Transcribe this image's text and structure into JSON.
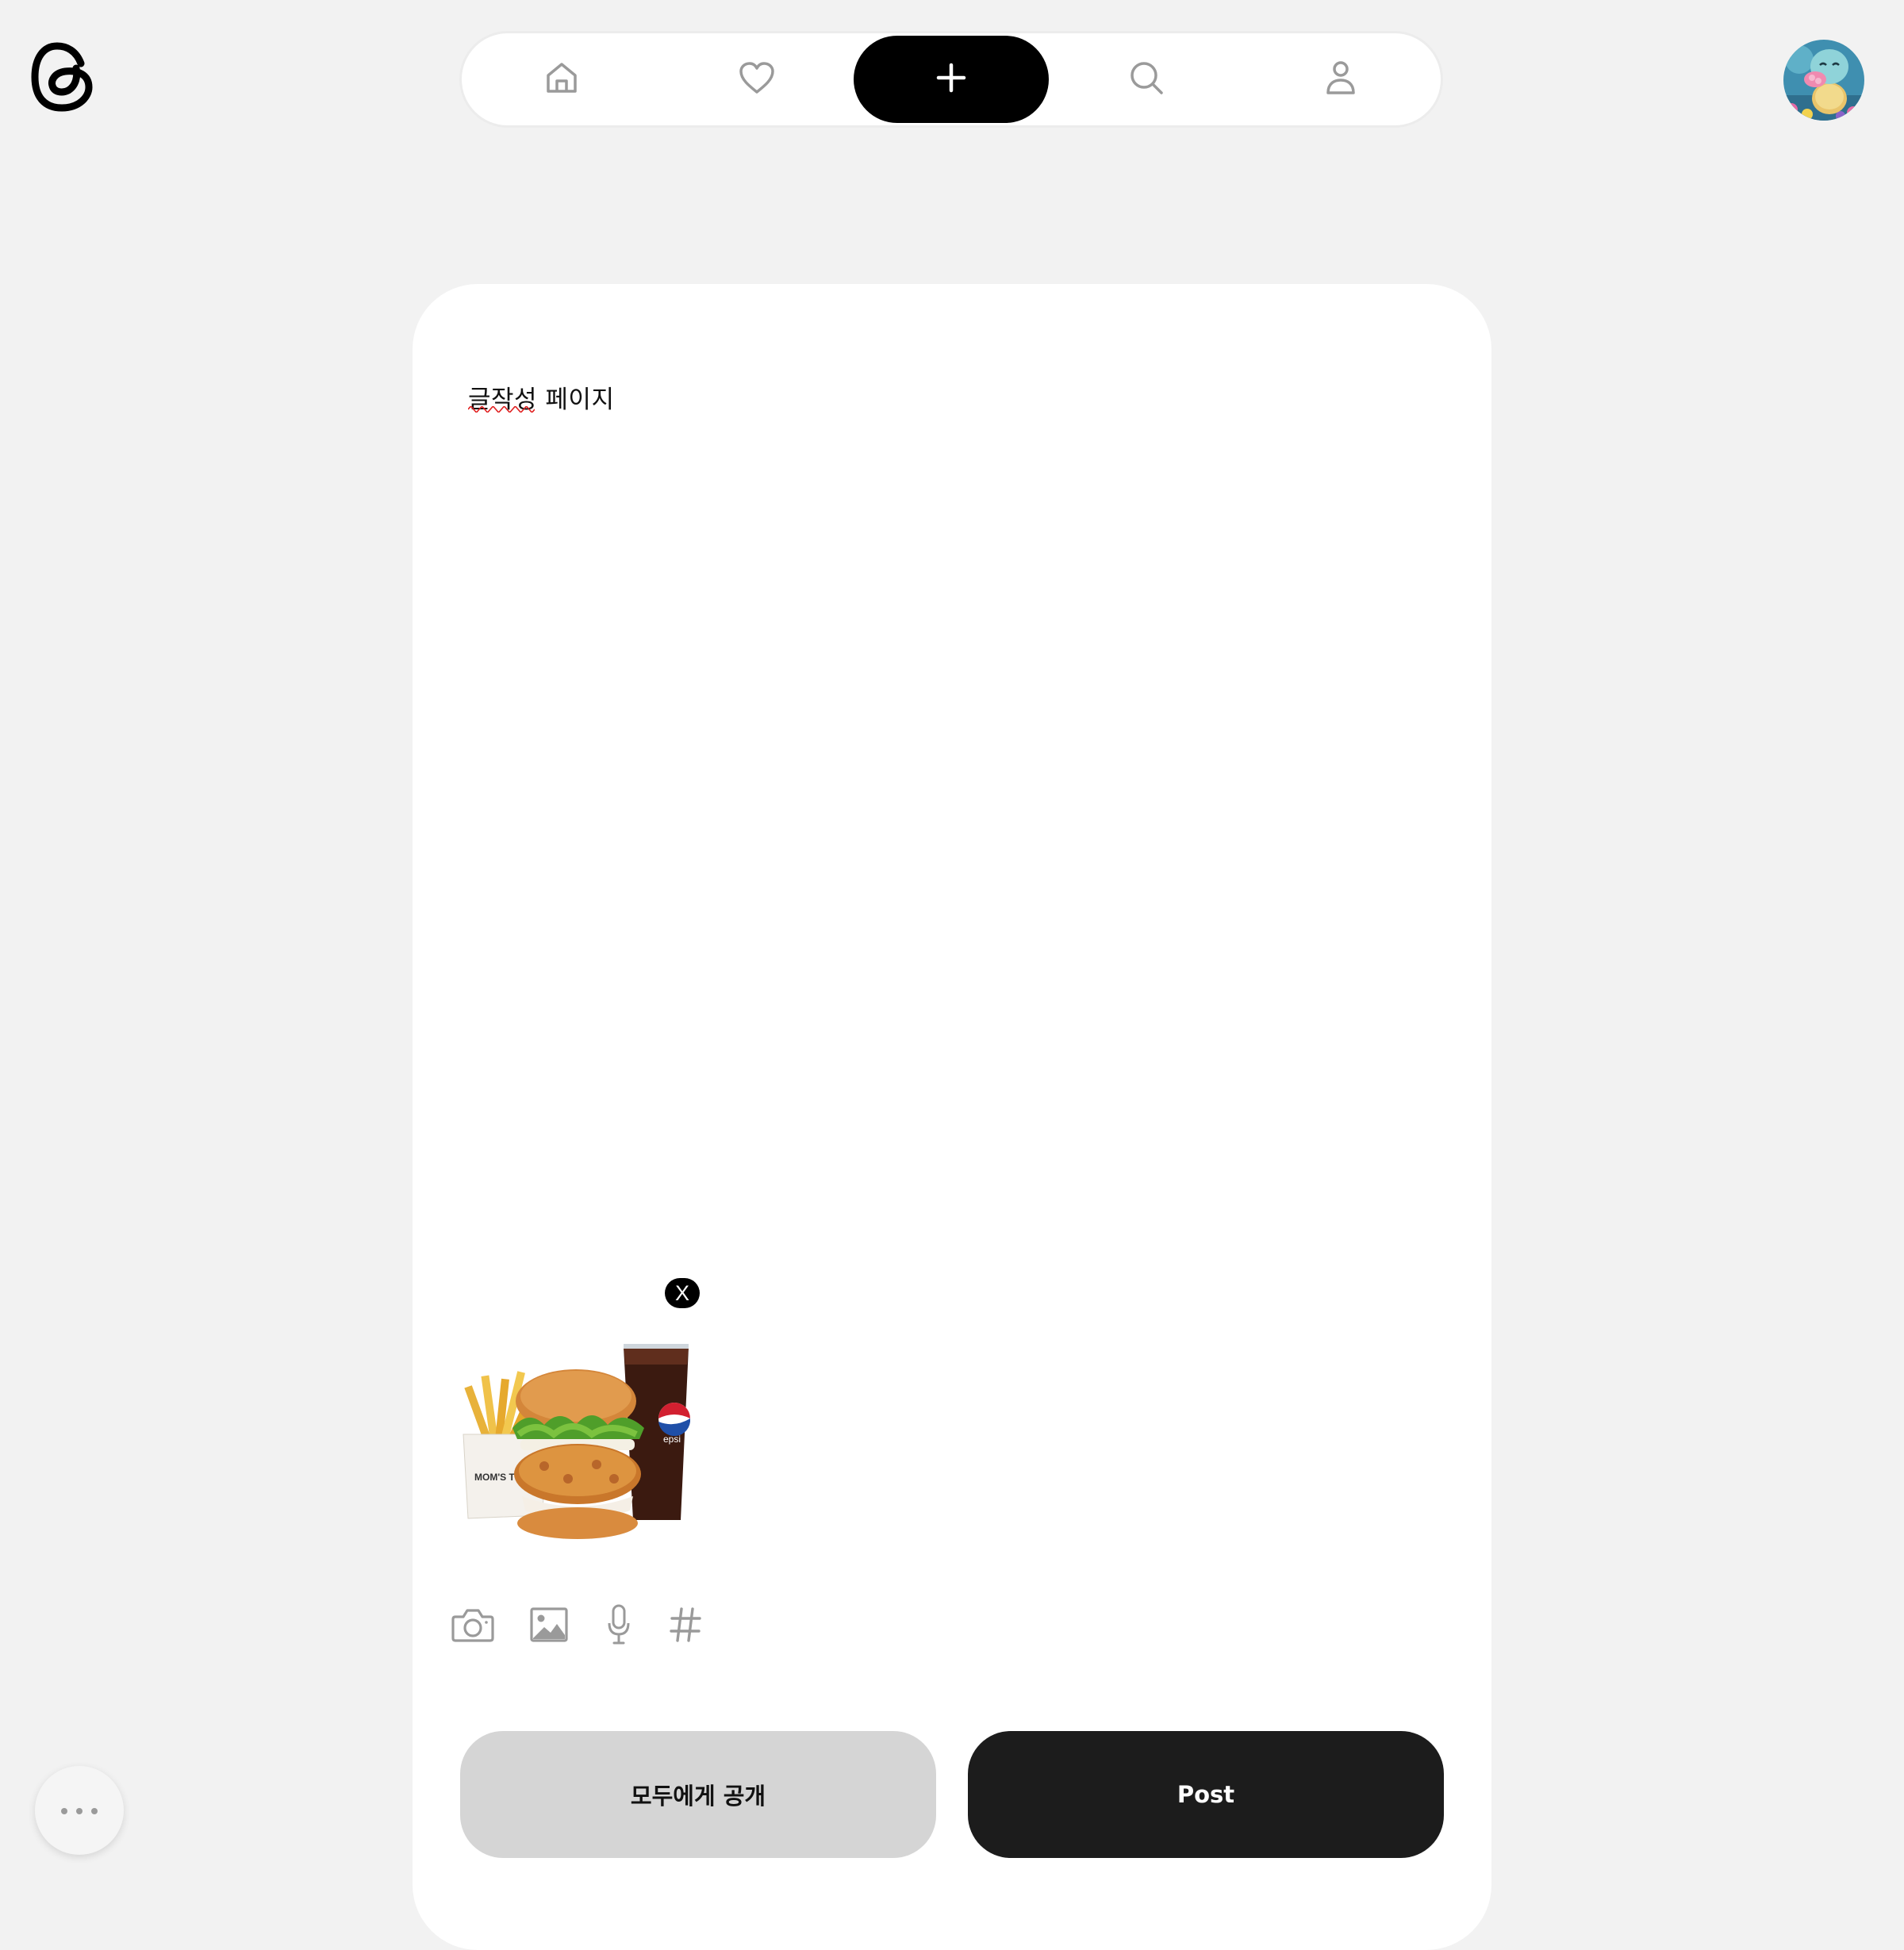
{
  "app": {
    "logo_icon": "threads-logo-icon"
  },
  "nav": {
    "items": [
      {
        "icon": "home-icon",
        "active": false
      },
      {
        "icon": "heart-icon",
        "active": false
      },
      {
        "icon": "plus-icon",
        "active": true
      },
      {
        "icon": "search-icon",
        "active": false
      },
      {
        "icon": "profile-icon",
        "active": false
      }
    ]
  },
  "user": {
    "avatar_icon": "avatar-image"
  },
  "composer": {
    "text": "글작성 페이지",
    "attachment": {
      "description_icon": "food-photo",
      "remove_label": "X"
    },
    "tools": [
      "camera-icon",
      "image-icon",
      "microphone-icon",
      "hashtag-icon"
    ],
    "audience_label": "모두에게 공개",
    "post_label": "Post"
  },
  "colors": {
    "background": "#f2f2f2",
    "card": "#ffffff",
    "active_nav": "#000000",
    "post_button": "#1c1c1c",
    "audience_button": "#d5d5d5",
    "icon_gray": "#9a9a9a"
  }
}
